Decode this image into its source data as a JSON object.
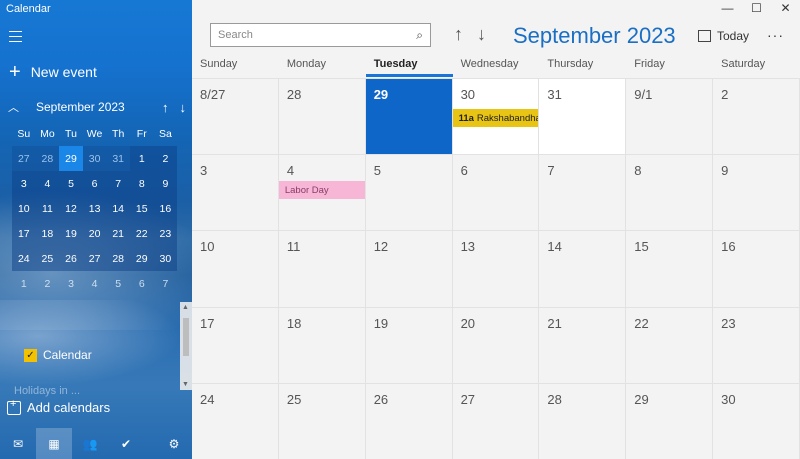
{
  "app": {
    "title": "Calendar"
  },
  "sidebar": {
    "new_event": "New event",
    "mini_calendar": {
      "month_label": "September 2023",
      "dow": [
        "Su",
        "Mo",
        "Tu",
        "We",
        "Th",
        "Fr",
        "Sa"
      ],
      "weeks": [
        [
          "27",
          "28",
          "29",
          "30",
          "31",
          "1",
          "2"
        ],
        [
          "3",
          "4",
          "5",
          "6",
          "7",
          "8",
          "9"
        ],
        [
          "10",
          "11",
          "12",
          "13",
          "14",
          "15",
          "16"
        ],
        [
          "17",
          "18",
          "19",
          "20",
          "21",
          "22",
          "23"
        ],
        [
          "24",
          "25",
          "26",
          "27",
          "28",
          "29",
          "30"
        ],
        [
          "1",
          "2",
          "3",
          "4",
          "5",
          "6",
          "7"
        ]
      ]
    },
    "calendar_checkbox_label": "Calendar",
    "partial_item": "Holidays in ...",
    "add_calendars": "Add calendars"
  },
  "toolbar": {
    "search_placeholder": "Search",
    "month_title": "September 2023",
    "today_label": "Today",
    "more_label": "···"
  },
  "window_controls": {
    "minimize": "—",
    "maximize": "☐",
    "close": "✕"
  },
  "month_view": {
    "weekdays": [
      "Sunday",
      "Monday",
      "Tuesday",
      "Wednesday",
      "Thursday",
      "Friday",
      "Saturday"
    ],
    "weeks": [
      [
        "8/27",
        "28",
        "29",
        "30",
        "31",
        "9/1",
        "2"
      ],
      [
        "3",
        "4",
        "5",
        "6",
        "7",
        "8",
        "9"
      ],
      [
        "10",
        "11",
        "12",
        "13",
        "14",
        "15",
        "16"
      ],
      [
        "17",
        "18",
        "19",
        "20",
        "21",
        "22",
        "23"
      ],
      [
        "24",
        "25",
        "26",
        "27",
        "28",
        "29",
        "30"
      ]
    ],
    "events": {
      "raksha": {
        "time": "11a",
        "title": "Rakshabandhan"
      },
      "labor": {
        "title": "Labor Day"
      }
    }
  },
  "colors": {
    "accent": "#1a6fc4",
    "today_cell": "#0f66c9",
    "event_yellow": "#e8c414",
    "event_pink": "#f7b6d6"
  }
}
